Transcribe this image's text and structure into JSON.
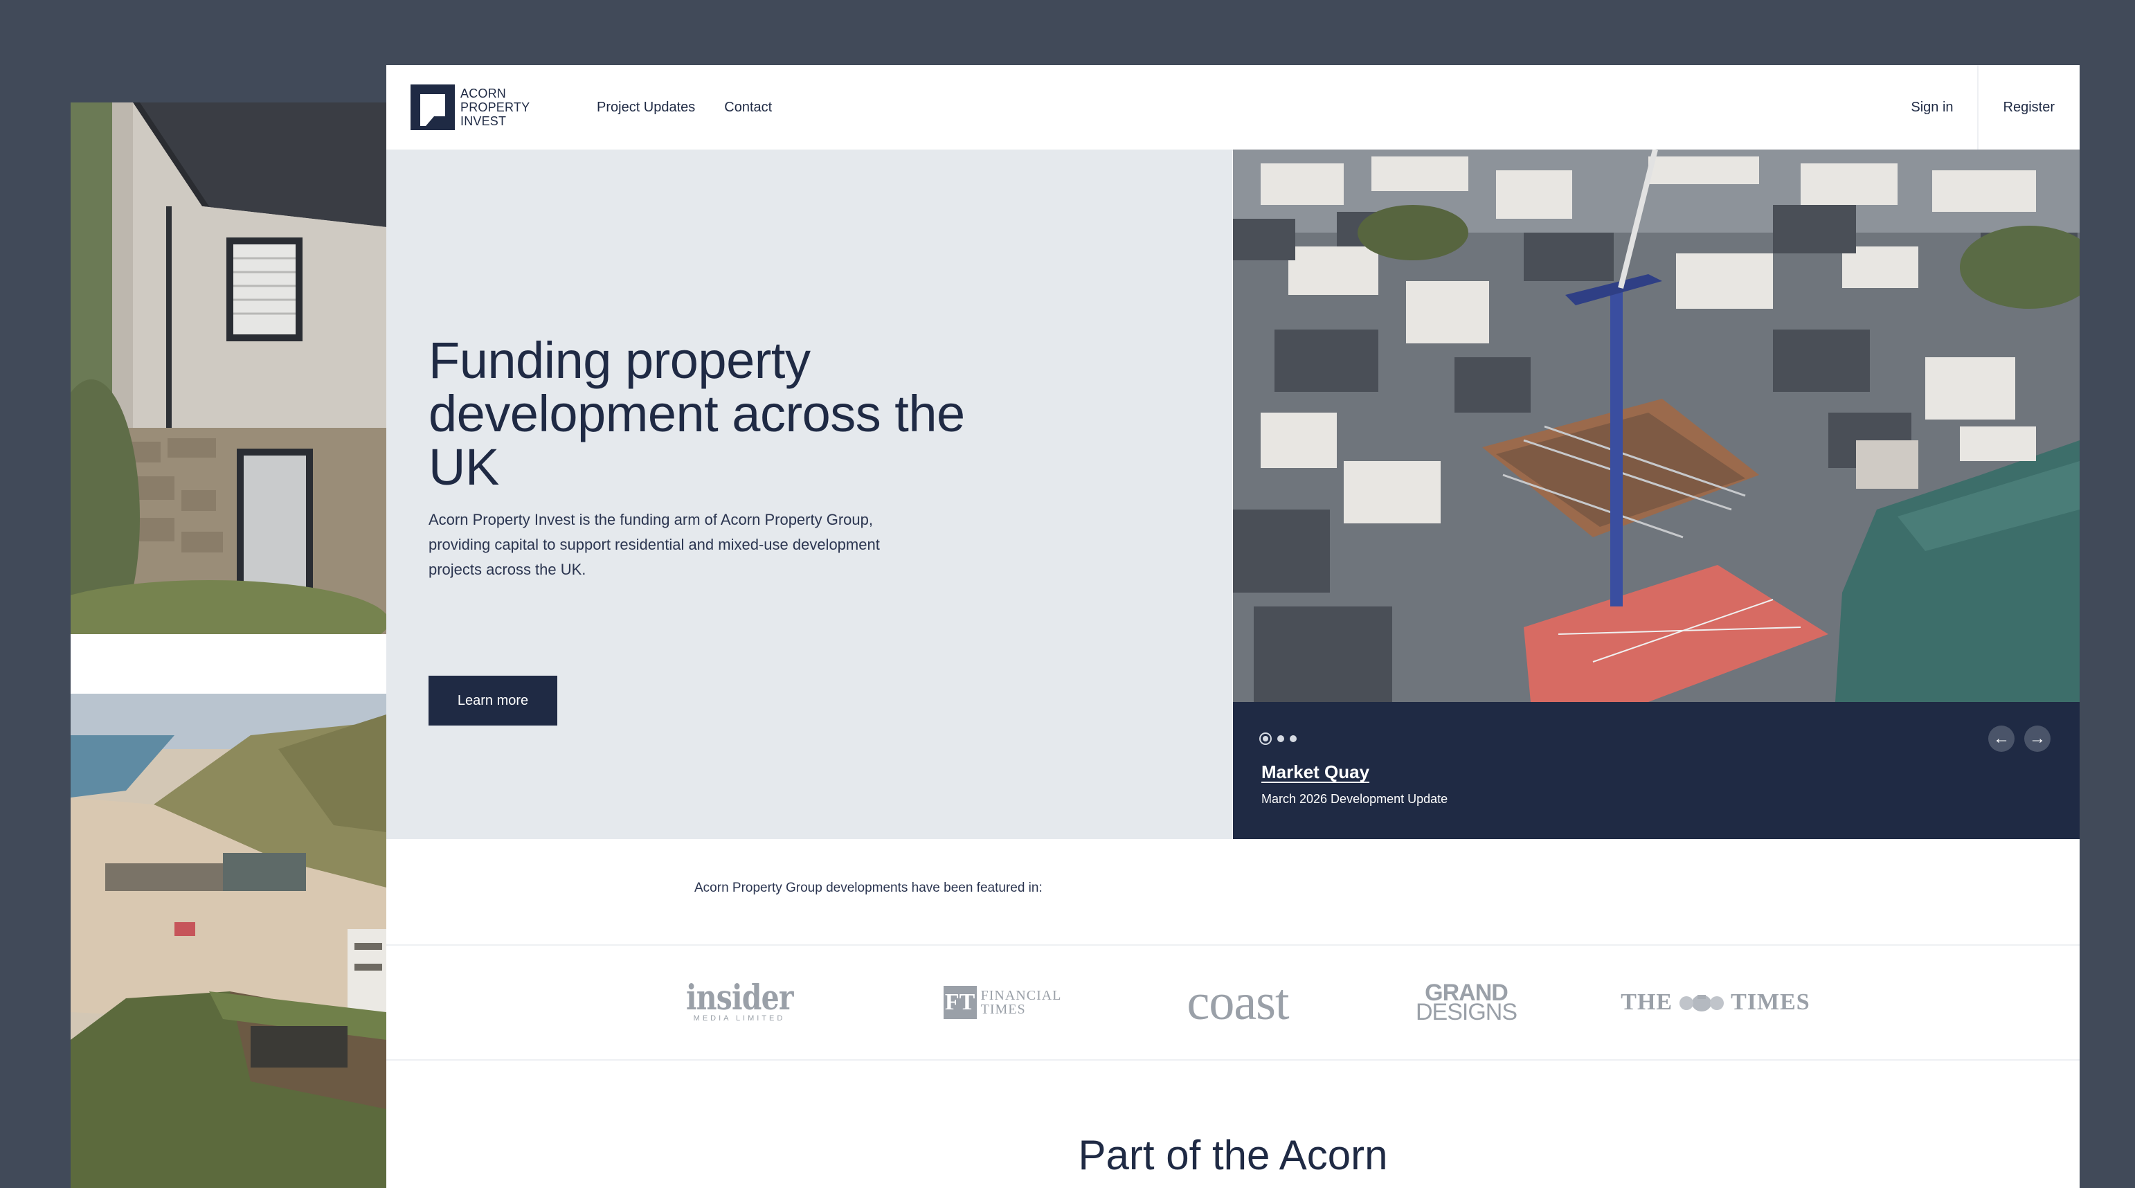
{
  "brand": {
    "line1": "ACORN",
    "line2": "PROPERTY",
    "line3": "INVEST"
  },
  "nav": {
    "items": [
      {
        "label": "Project Updates"
      },
      {
        "label": "Contact"
      }
    ]
  },
  "auth": {
    "sign_in": "Sign in",
    "register": "Register"
  },
  "hero": {
    "title": "Funding property development across the UK",
    "description": "Acorn Property Invest is the funding arm of Acorn Property Group, providing capital to support residential and mixed-use development projects across the UK.",
    "cta_label": "Learn more"
  },
  "slider": {
    "slide_count": 3,
    "active_index": 0,
    "title": "Market Quay",
    "subtitle": "March 2026 Development Update",
    "prev_icon": "arrow-left-icon",
    "next_icon": "arrow-right-icon",
    "prev_glyph": "←",
    "next_glyph": "→"
  },
  "featured": {
    "intro": "Acorn Property Group developments have been featured in:",
    "logos": {
      "insider": {
        "main": "insider",
        "sub": "MEDIA LIMITED"
      },
      "ft": {
        "mark": "FT",
        "line1": "FINANCIAL",
        "line2": "TIMES"
      },
      "coast": {
        "main": "coast"
      },
      "grand_designs": {
        "line1": "GRAND",
        "line2": "DESIGNS"
      },
      "times": {
        "left": "THE",
        "right": "TIMES"
      }
    }
  },
  "section": {
    "title": "Part of the Acorn"
  },
  "colors": {
    "navy": "#1f2a44",
    "hero_bg": "#e5e9ed",
    "page_bg": "#414a59",
    "logo_grey": "#9aa0a8"
  }
}
